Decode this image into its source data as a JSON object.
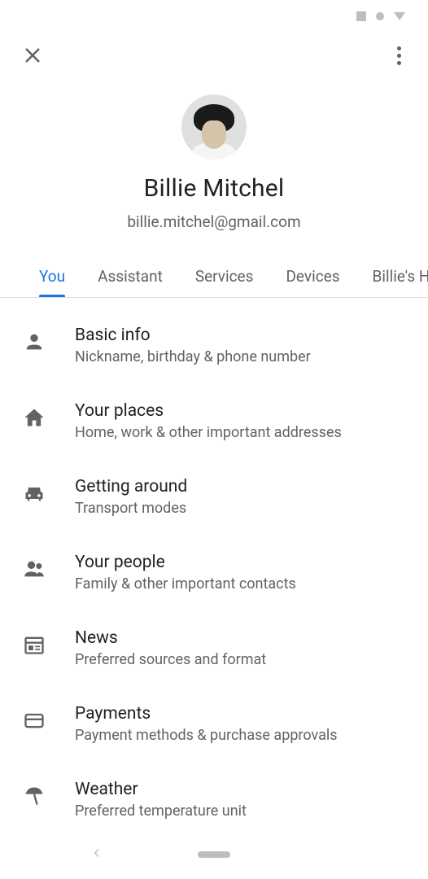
{
  "profile": {
    "name": "Billie Mitchel",
    "email": "billie.mitchel@gmail.com"
  },
  "tabs": [
    {
      "label": "You",
      "active": true
    },
    {
      "label": "Assistant",
      "active": false
    },
    {
      "label": "Services",
      "active": false
    },
    {
      "label": "Devices",
      "active": false
    },
    {
      "label": "Billie's H",
      "active": false
    }
  ],
  "settings": [
    {
      "icon": "person",
      "title": "Basic info",
      "subtitle": "Nickname, birthday & phone number"
    },
    {
      "icon": "home",
      "title": "Your places",
      "subtitle": "Home, work & other important addresses"
    },
    {
      "icon": "car",
      "title": "Getting around",
      "subtitle": "Transport modes"
    },
    {
      "icon": "people",
      "title": "Your people",
      "subtitle": "Family & other important contacts"
    },
    {
      "icon": "news",
      "title": "News",
      "subtitle": "Preferred sources and format"
    },
    {
      "icon": "payment",
      "title": "Payments",
      "subtitle": "Payment methods & purchase approvals"
    },
    {
      "icon": "weather",
      "title": "Weather",
      "subtitle": "Preferred temperature unit"
    }
  ]
}
